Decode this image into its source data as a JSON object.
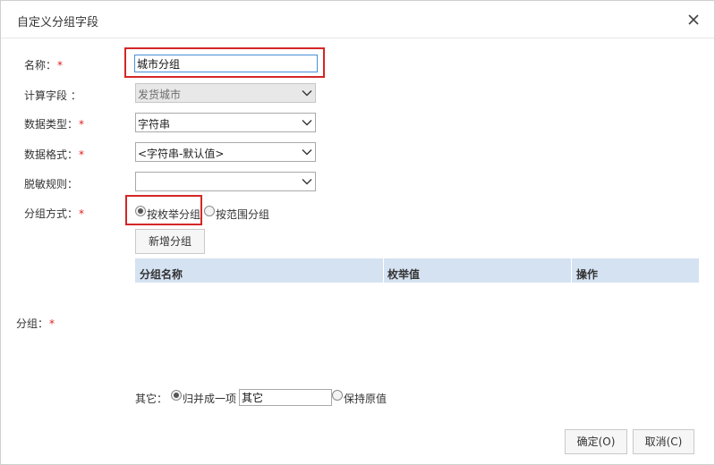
{
  "dialog": {
    "title": "自定义分组字段",
    "close_icon": "close-icon"
  },
  "form": {
    "name": {
      "label": "名称：",
      "required_mark": "*",
      "value": "城市分组"
    },
    "calc_field": {
      "label": "计算字段 ：",
      "value": "发货城市"
    },
    "data_type": {
      "label": "数据类型：",
      "required_mark": "*",
      "value": "字符串"
    },
    "data_format": {
      "label": "数据格式：",
      "required_mark": "*",
      "value": "<字符串-默认值>"
    },
    "mask_rule": {
      "label": "脱敏规则：",
      "value": ""
    },
    "group_mode": {
      "label": "分组方式：",
      "required_mark": "*",
      "options": [
        {
          "label": "按枚举分组",
          "selected": true
        },
        {
          "label": "按范围分组",
          "selected": false
        }
      ]
    },
    "add_group_button": "新增分组",
    "group_table": {
      "columns": [
        "分组名称",
        "枚举值",
        "操作"
      ],
      "rows": []
    },
    "group": {
      "label": "分组：",
      "required_mark": "*"
    },
    "other": {
      "label": "其它：",
      "options": [
        {
          "label": "归并成一项",
          "selected": true
        },
        {
          "label": "保持原值",
          "selected": false
        }
      ],
      "merge_value": "其它"
    }
  },
  "footer": {
    "ok_button": "确定(O)",
    "cancel_button": "取消(C)"
  },
  "colors": {
    "highlight": "#d42626",
    "required": "#e02020",
    "table_header": "#d5e2f2",
    "focus_border": "#4a8fd6"
  }
}
